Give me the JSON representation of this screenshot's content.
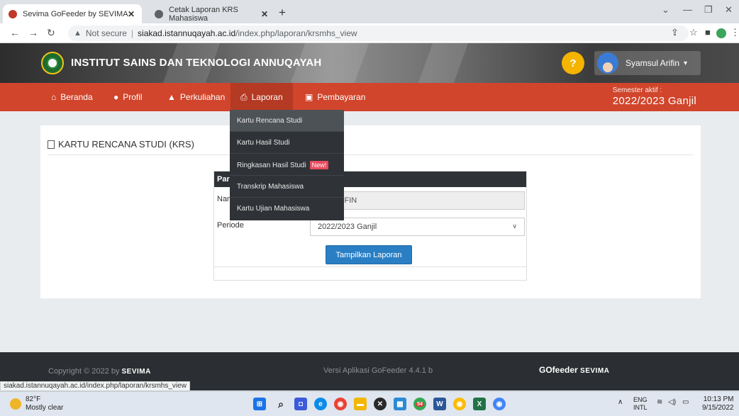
{
  "browser": {
    "tabs": [
      {
        "title": "Sevima GoFeeder by SEVIMA",
        "active": true
      },
      {
        "title": "Cetak Laporan KRS Mahasiswa",
        "active": false
      }
    ],
    "url_security": "Not secure",
    "url_host": "siakad.istannuqayah.ac.id",
    "url_path": "/index.php/laporan/krsmhs_view"
  },
  "header": {
    "institution": "INSTITUT SAINS DAN TEKNOLOGI ANNUQAYAH",
    "username": "Syamsul Arifin"
  },
  "nav": {
    "items": [
      {
        "label": "Beranda",
        "icon": "home-icon"
      },
      {
        "label": "Profil",
        "icon": "user-icon"
      },
      {
        "label": "Perkuliahan",
        "icon": "graduation-cap-icon"
      },
      {
        "label": "Laporan",
        "icon": "printer-icon"
      },
      {
        "label": "Pembayaran",
        "icon": "money-icon"
      }
    ],
    "semester_label": "Semester aktif :",
    "semester_value": "2022/2023 Ganjil"
  },
  "dropdown": {
    "items": [
      {
        "label": "Kartu Rencana Studi"
      },
      {
        "label": "Kartu Hasil Studi"
      },
      {
        "label": "Ringkasan Hasil Studi",
        "badge": "New!"
      },
      {
        "label": "Transkrip Mahasiswa"
      },
      {
        "label": "Kartu Ujian Mahasiswa"
      }
    ]
  },
  "page": {
    "title": "KARTU RENCANA STUDI (KRS)",
    "form_header": "Para",
    "name_label": "Nam",
    "period_label": "Periode",
    "name_value": "UL ARIIFIN",
    "period_value": "2022/2023 Ganjil",
    "submit_label": "Tampilkan Laporan"
  },
  "footer": {
    "copyright": "Copyright © 2022 by",
    "brand": "SEVIMA",
    "version": "Versi Aplikasi GoFeeder 4.4.1 b",
    "logo_go": "GOfeeder",
    "logo_sevima": "SEVIMA"
  },
  "status_url": "siakad.istannuqayah.ac.id/index.php/laporan/krsmhs_view",
  "taskbar": {
    "temperature": "82°F",
    "weather": "Mostly clear",
    "lang_top": "ENG",
    "lang_bottom": "INTL",
    "time": "10:13 PM",
    "date": "9/15/2022",
    "chrome_badge": "54"
  }
}
